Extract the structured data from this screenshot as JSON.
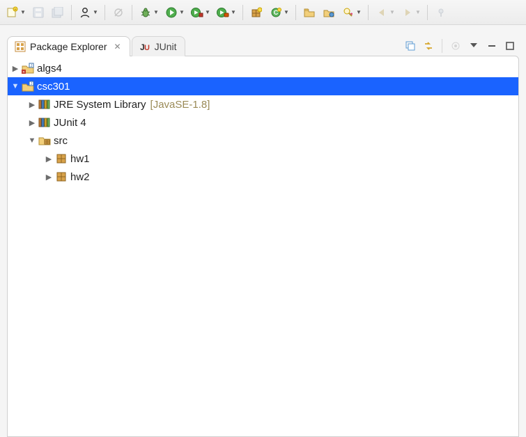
{
  "tabs": {
    "active": {
      "label": "Package Explorer"
    },
    "inactive": {
      "label": "JUnit"
    }
  },
  "tree": {
    "algs4": "algs4",
    "csc301": "csc301",
    "jre": {
      "label": "JRE System Library",
      "suffix": "[JavaSE-1.8]"
    },
    "junit4": "JUnit 4",
    "src": "src",
    "hw1": "hw1",
    "hw2": "hw2"
  }
}
